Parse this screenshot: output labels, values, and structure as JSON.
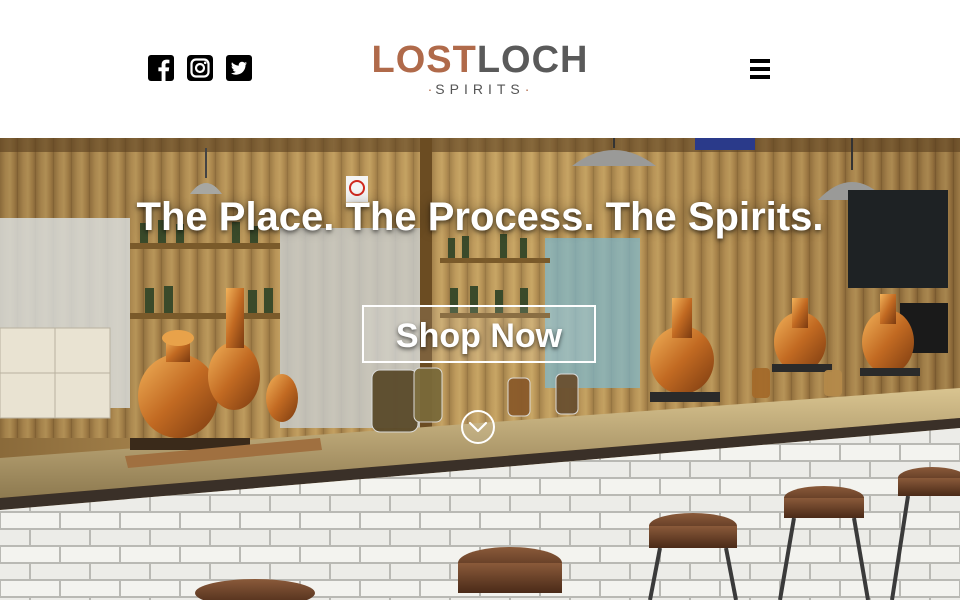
{
  "header": {
    "social": [
      {
        "name": "facebook-icon",
        "label": "Facebook"
      },
      {
        "name": "instagram-icon",
        "label": "Instagram"
      },
      {
        "name": "twitter-icon",
        "label": "Twitter"
      }
    ],
    "logo": {
      "part1": "L",
      "part1_o": "O",
      "part1_rest": "ST",
      "part2": "LOCH",
      "subtitle": "SPIRITS"
    },
    "menu_icon": "hamburger-menu-icon"
  },
  "hero": {
    "title": "The Place. The Process. The Spirits.",
    "cta_label": "Shop Now",
    "scroll_icon": "chevron-down-circle-icon",
    "colors": {
      "logo_copper": "#b06a4a",
      "logo_grey": "#5a5a5a"
    }
  }
}
